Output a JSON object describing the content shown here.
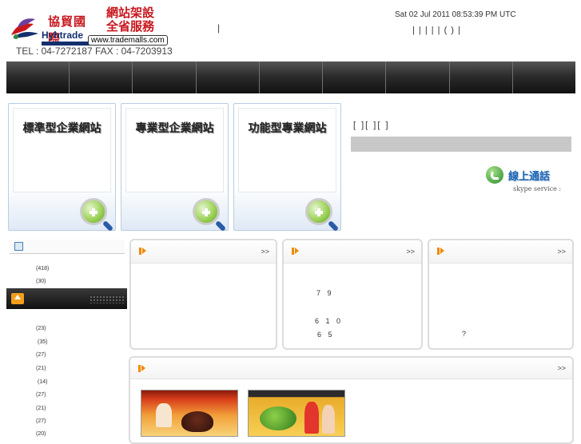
{
  "header": {
    "logo_cn": "協貿國際",
    "logo_en": "Hyhtrade",
    "slogan_line1": "網站架設",
    "slogan_line2": "全省服務",
    "url": "www.trademalls.com",
    "telfax": "TEL : 04-7272187 FAX : 04-7203913",
    "separator": "|",
    "datetime": "Sat 02 Jul 2011 08:53:39 PM UTC",
    "toplinks": "|   |   |   |   |  ( ) |"
  },
  "products": [
    {
      "title": "標準型企業網站"
    },
    {
      "title": "專業型企業網站"
    },
    {
      "title": "功能型專業網站"
    }
  ],
  "right_top": {
    "brackets": "[   ][   ][   ]",
    "skype_title": "線上通話",
    "skype_sub": "skype service :"
  },
  "sidebar": {
    "counts_top": [
      "(418)",
      "(30)"
    ],
    "counts": [
      "(23)",
      "(35)",
      "(27)",
      "(21)",
      "(14)",
      "(27)",
      "(21)",
      "(27)",
      "(20)"
    ]
  },
  "panels": [
    {
      "more": ">>",
      "texts": []
    },
    {
      "more": ">>",
      "texts": [
        "7 9",
        "6 1 0",
        "6 5"
      ]
    },
    {
      "more": ">>",
      "texts": [
        "?"
      ]
    }
  ],
  "wide_panel": {
    "more": ">>"
  },
  "colors": {
    "accent": "#f08a00",
    "nav_dark": "#2c2c2c",
    "brand_red": "#c8171e",
    "brand_blue": "#13306e"
  }
}
